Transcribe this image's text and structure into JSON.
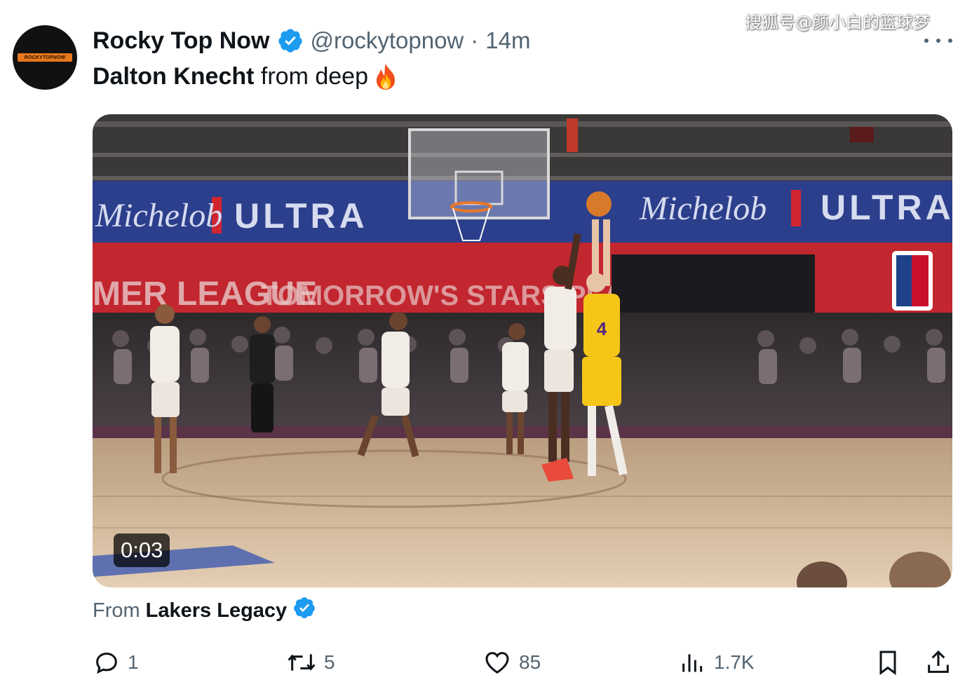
{
  "watermark": "搜狐号@颜小白的篮球梦",
  "author": {
    "avatar_text": "ROCKYTOPNOW",
    "display_name": "Rocky Top Now",
    "verified_icon": "verified-badge-icon",
    "handle": "@rockytopnow",
    "separator": "·",
    "time": "14m"
  },
  "tweet": {
    "text_bold": "Dalton Knecht",
    "text_rest": " from deep",
    "emoji": "fire-icon"
  },
  "media": {
    "type": "video",
    "duration": "0:03"
  },
  "source": {
    "prefix": "From",
    "name": "Lakers Legacy",
    "verified_icon": "verified-badge-icon"
  },
  "actions": {
    "replies": "1",
    "reposts": "5",
    "likes": "85",
    "views": "1.7K"
  },
  "colors": {
    "text_primary": "#0f1419",
    "text_secondary": "#536471",
    "verified_blue": "#1d9bf0"
  }
}
